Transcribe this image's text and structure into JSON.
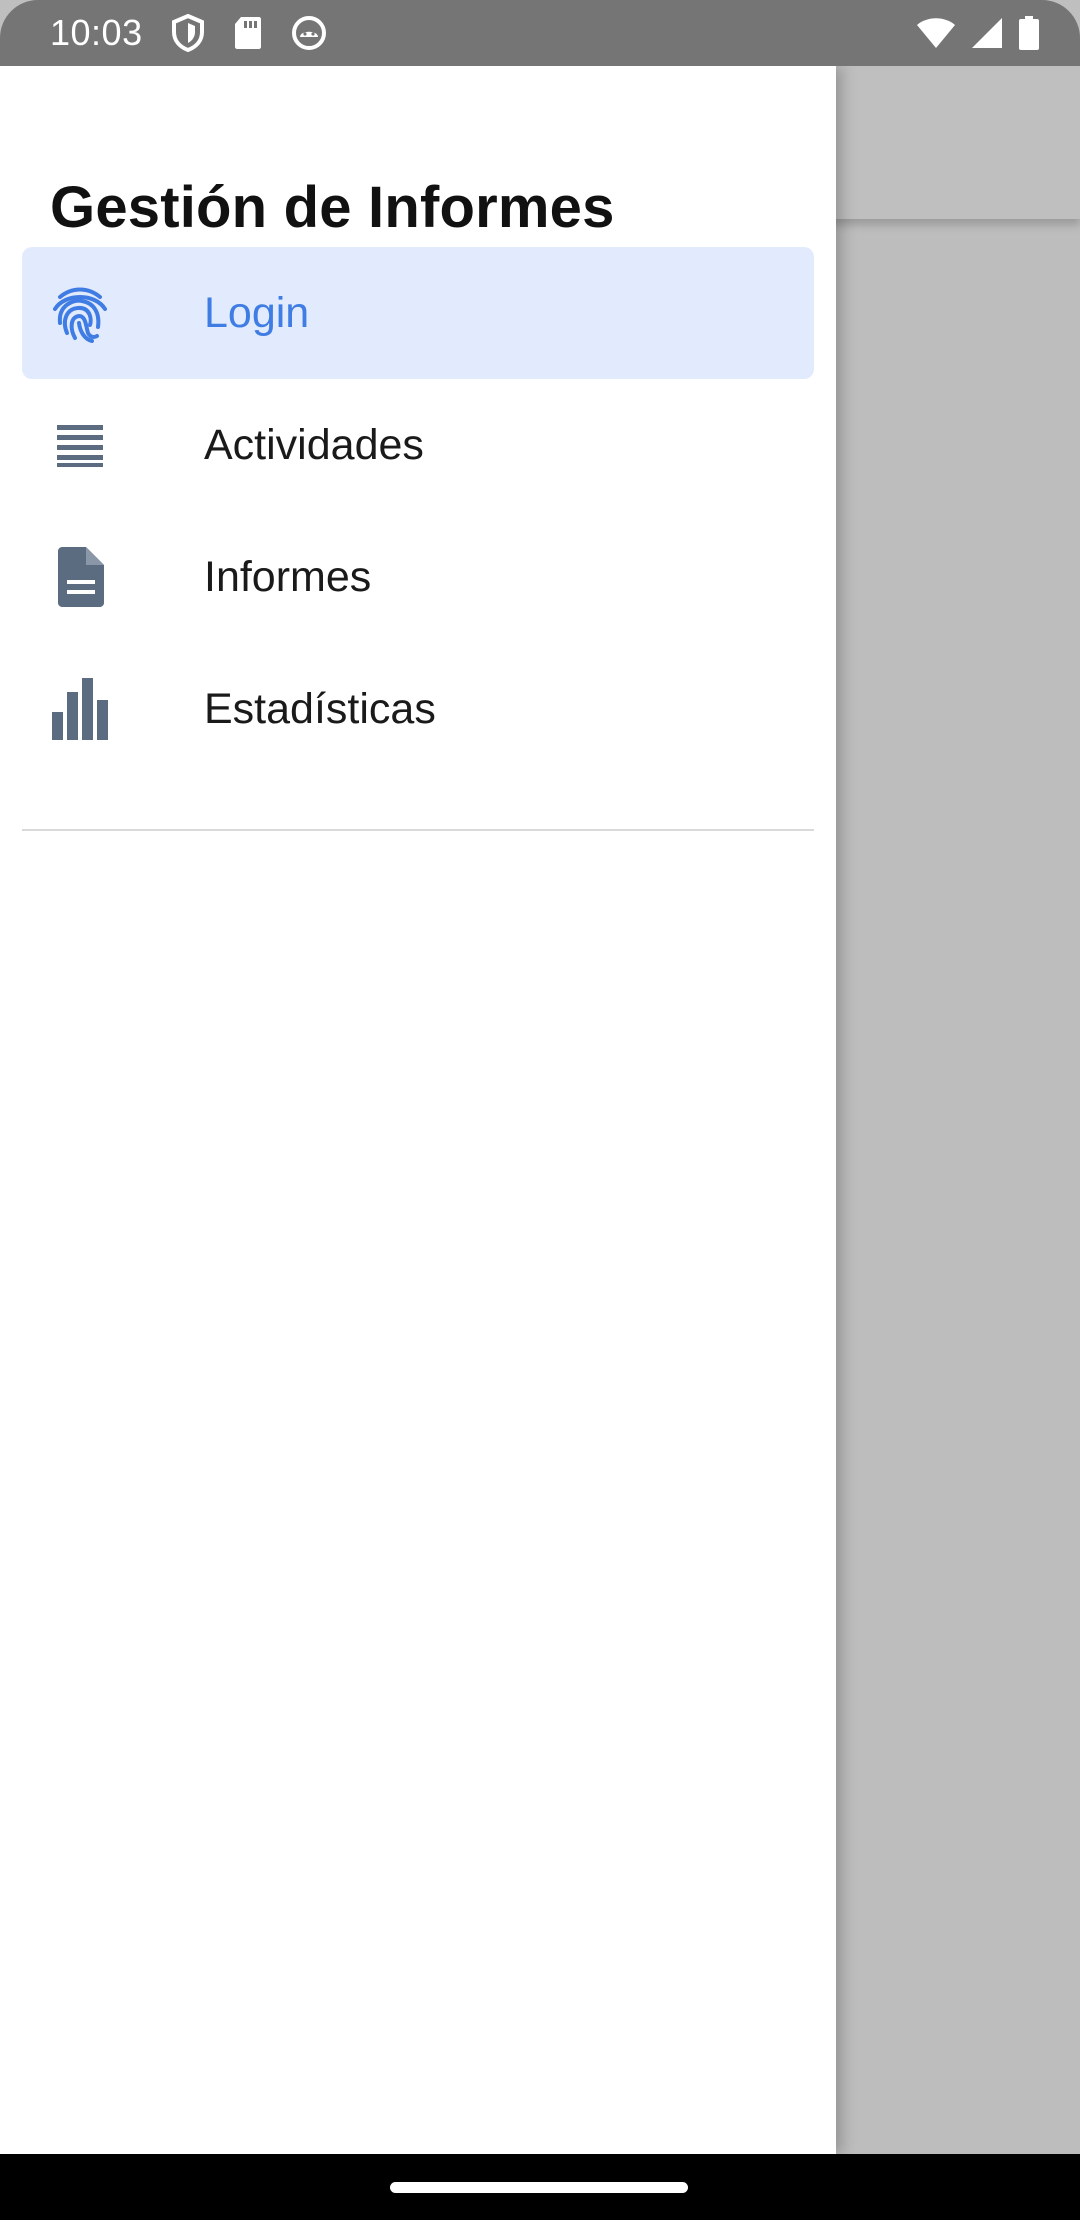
{
  "status_bar": {
    "time": "10:03",
    "left_icons": [
      "shield-icon",
      "sd-card-icon",
      "android-debug-icon"
    ],
    "right_icons": [
      "wifi-icon",
      "cellular-signal-icon",
      "battery-icon"
    ]
  },
  "drawer": {
    "title": "Gestión de Informes",
    "items": [
      {
        "label": "Login",
        "icon": "fingerprint-icon",
        "active": true
      },
      {
        "label": "Actividades",
        "icon": "list-lines-icon",
        "active": false
      },
      {
        "label": "Informes",
        "icon": "document-icon",
        "active": false
      },
      {
        "label": "Estadísticas",
        "icon": "bar-chart-icon",
        "active": false
      }
    ]
  },
  "colors": {
    "accent": "#3f7ce3",
    "active_bg": "#e2ebfd",
    "icon_gray": "#5b6b80",
    "status_bar": "#757575",
    "scrim": "#bfbfbf"
  }
}
